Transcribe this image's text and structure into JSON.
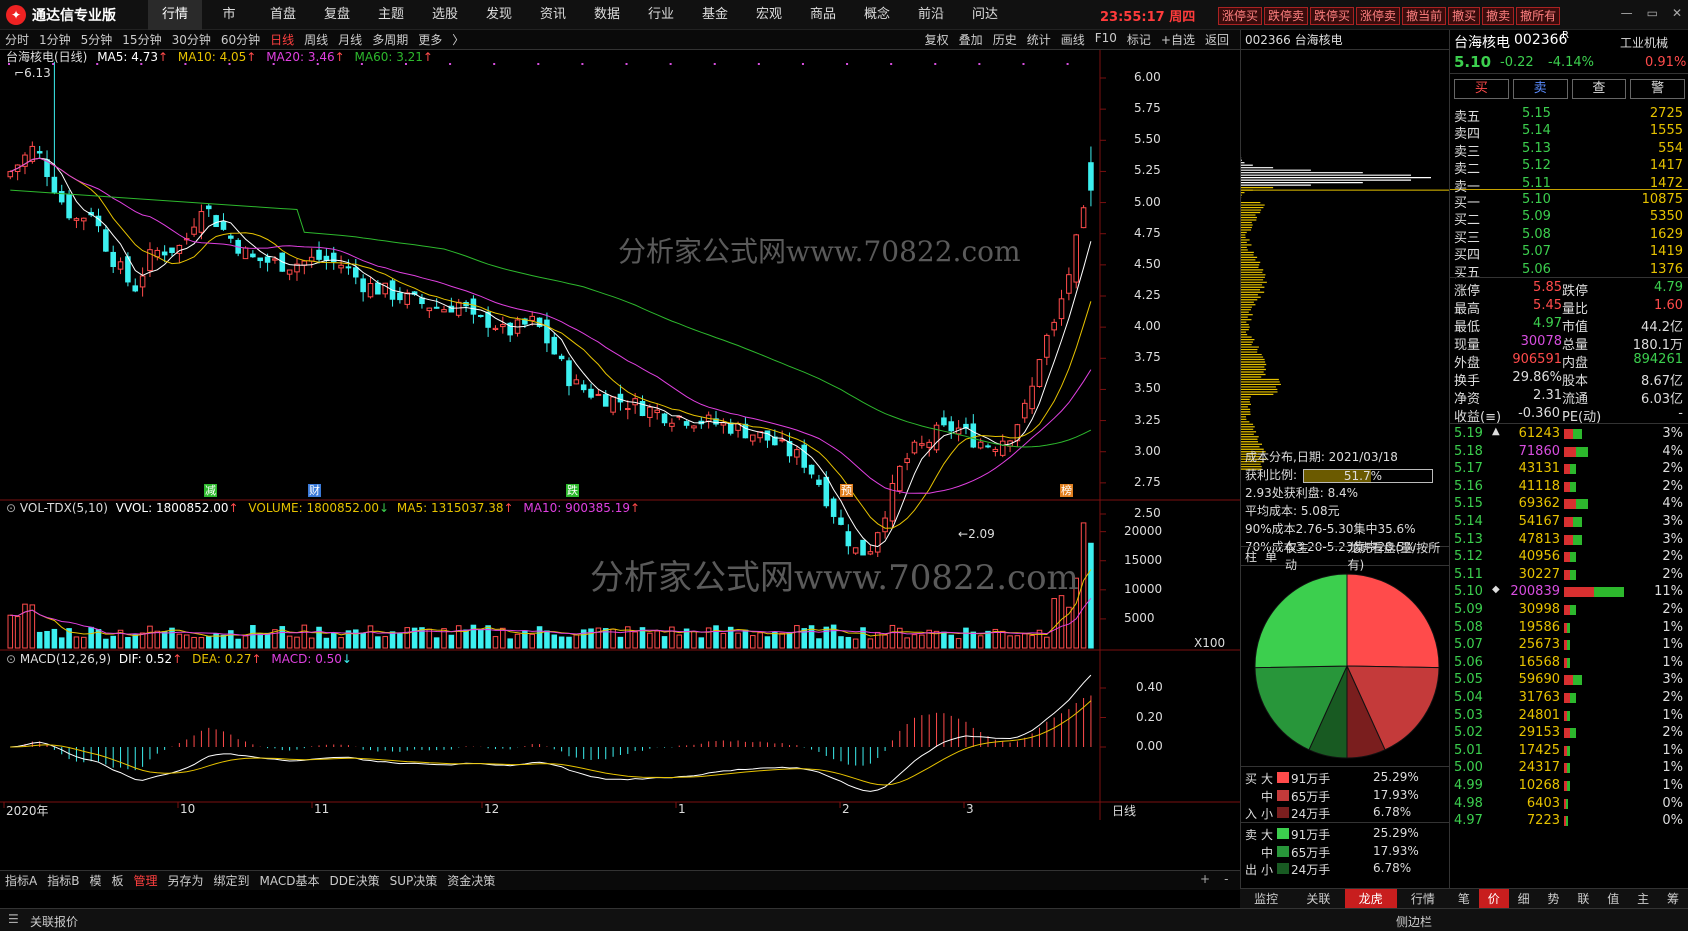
{
  "app": {
    "title": "通达信专业版"
  },
  "nav": [
    "行情",
    "市",
    "首盘",
    "复盘",
    "主题",
    "选股",
    "发现",
    "资讯",
    "数据",
    "行业",
    "基金",
    "宏观",
    "商品",
    "概念",
    "前沿",
    "问达"
  ],
  "clock": {
    "time": "23:55:17",
    "day": "周四"
  },
  "trade_buttons": [
    "涨停买",
    "跌停卖",
    "跌停买",
    "涨停卖",
    "撤当前",
    "撤买",
    "撤卖",
    "撤所有"
  ],
  "toolbar": {
    "periods": [
      "分时",
      "1分钟",
      "5分钟",
      "15分钟",
      "30分钟",
      "60分钟",
      "日线",
      "周线",
      "月线",
      "多周期",
      "更多"
    ],
    "active": "日线",
    "tools": [
      "复权",
      "叠加",
      "历史",
      "统计",
      "画线",
      "F10",
      "标记",
      "+自选",
      "返回"
    ]
  },
  "main_legend": {
    "name": "台海核电(日线)",
    "ma5": "MA5: 4.73",
    "ma10": "MA10: 4.05",
    "ma20": "MA20: 3.46",
    "ma60": "MA60: 3.21"
  },
  "annot": {
    "high": "6.13",
    "low": "2.09"
  },
  "event_tags": [
    "减",
    "财",
    "跌",
    "预",
    "榜"
  ],
  "watermark": "分析家公式网www.70822.com",
  "price_axis": [
    "6.00",
    "5.75",
    "5.50",
    "5.25",
    "5.00",
    "4.75",
    "4.50",
    "4.25",
    "4.00",
    "3.75",
    "3.50",
    "3.25",
    "3.00",
    "2.75",
    "2.50"
  ],
  "vol_legend": {
    "name": "VOL-TDX(5,10)",
    "vvol": "VVOL: 1800852.00",
    "volume": "VOLUME: 1800852.00",
    "ma5": "MA5: 1315037.38",
    "ma10": "MA10: 900385.19"
  },
  "vol_axis": [
    "20000",
    "15000",
    "10000",
    "5000"
  ],
  "vol_unit": "X100",
  "macd_legend": {
    "name": "MACD(12,26,9)",
    "dif": "DIF: 0.52",
    "dea": "DEA: 0.27",
    "macd": "MACD: 0.50"
  },
  "macd_axis": [
    "0.40",
    "0.20",
    "0.00"
  ],
  "date_axis": [
    "2020年",
    "10",
    "11",
    "12",
    "1",
    "2",
    "3"
  ],
  "date_axis_right": "日线",
  "bottom_tabs": [
    "指标A",
    "指标B",
    "模",
    "板",
    "管理",
    "另存为",
    "绑定到",
    "MACD基本",
    "DDE决策",
    "SUP决策",
    "资金决策"
  ],
  "bottom_active": "管理",
  "status": {
    "left": "关联报价",
    "right": "侧边栏"
  },
  "mid": {
    "code": "002366 台海核电",
    "cost": {
      "date": "成本分布,日期: 2021/03/18",
      "profit_label": "获利比例:",
      "profit": "51.7%",
      "line1": "2.93处获利盘: 8.4%",
      "line2": "平均成本: 5.08元",
      "line3": "90%成本2.76-5.30集中35.6%",
      "line4": "70%成本3.20-5.23集中28.5%"
    },
    "tabs": [
      "柱",
      "单",
      "仅主动",
      "龙虎看盘(量/按所有)"
    ],
    "flow": {
      "buy": [
        {
          "k": "大",
          "v": "91万手",
          "p": "25.29%",
          "c": "#ff4b4b"
        },
        {
          "k": "中",
          "v": "65万手",
          "p": "17.93%",
          "c": "#c43a3a"
        },
        {
          "k": "小",
          "v": "24万手",
          "p": "6.78%",
          "c": "#7a1e1e"
        }
      ],
      "sell": [
        {
          "k": "大",
          "v": "91万手",
          "p": "25.29%",
          "c": "#3ccf4e"
        },
        {
          "k": "中",
          "v": "65万手",
          "p": "17.93%",
          "c": "#28963a"
        },
        {
          "k": "小",
          "v": "24万手",
          "p": "6.78%",
          "c": "#185a22"
        }
      ],
      "side_buy": [
        "买",
        "入"
      ],
      "side_sell": [
        "卖",
        "出"
      ]
    },
    "bottom_tabs": [
      "监控",
      "关联",
      "龙虎",
      "行情"
    ],
    "bottom_active": "龙虎"
  },
  "quote": {
    "name": "台海核电",
    "code": "002366",
    "tag": "R",
    "industry": "工业机械",
    "price": "5.10",
    "chg": "-0.22",
    "pct": "-4.14%",
    "ratio": "0.91%",
    "buttons": [
      "买",
      "卖",
      "查",
      "警"
    ],
    "asks": [
      {
        "l": "卖五",
        "p": "5.15",
        "v": "2725"
      },
      {
        "l": "卖四",
        "p": "5.14",
        "v": "1555"
      },
      {
        "l": "卖三",
        "p": "5.13",
        "v": "554"
      },
      {
        "l": "卖二",
        "p": "5.12",
        "v": "1417"
      },
      {
        "l": "卖一",
        "p": "5.11",
        "v": "1472"
      }
    ],
    "bids": [
      {
        "l": "买一",
        "p": "5.10",
        "v": "10875"
      },
      {
        "l": "买二",
        "p": "5.09",
        "v": "5350"
      },
      {
        "l": "买三",
        "p": "5.08",
        "v": "1629"
      },
      {
        "l": "买四",
        "p": "5.07",
        "v": "1419"
      },
      {
        "l": "买五",
        "p": "5.06",
        "v": "1376"
      }
    ],
    "stats": [
      [
        {
          "l": "涨停",
          "v": "5.85",
          "c": "#ff4b4b"
        },
        {
          "l": "跌停",
          "v": "4.79",
          "c": "#3ccf4e"
        }
      ],
      [
        {
          "l": "最高",
          "v": "5.45",
          "c": "#ff4b4b"
        },
        {
          "l": "量比",
          "v": "1.60",
          "c": "#ff4b4b"
        }
      ],
      [
        {
          "l": "最低",
          "v": "4.97",
          "c": "#3ccf4e"
        },
        {
          "l": "市值",
          "v": "44.2亿",
          "c": "#ddd"
        }
      ],
      [
        {
          "l": "现量",
          "v": "30078",
          "c": "#d84ee0"
        },
        {
          "l": "总量",
          "v": "180.1万",
          "c": "#ddd"
        }
      ],
      [
        {
          "l": "外盘",
          "v": "906591",
          "c": "#ff4b4b"
        },
        {
          "l": "内盘",
          "v": "894261",
          "c": "#3ccf4e"
        }
      ],
      [
        {
          "l": "换手",
          "v": "29.86%",
          "c": "#ddd"
        },
        {
          "l": "股本",
          "v": "8.67亿",
          "c": "#ddd"
        }
      ],
      [
        {
          "l": "净资",
          "v": "2.31",
          "c": "#ddd"
        },
        {
          "l": "流通",
          "v": "6.03亿",
          "c": "#ddd"
        }
      ],
      [
        {
          "l": "收益(≡)",
          "v": "-0.360",
          "c": "#ddd"
        },
        {
          "l": "PE(动)",
          "v": "-",
          "c": "#ddd"
        }
      ]
    ],
    "ladder": [
      {
        "p": "5.19",
        "v": "61243",
        "pc": "3%",
        "m": "▲"
      },
      {
        "p": "5.18",
        "v": "71860",
        "pc": "4%",
        "m": "",
        "vc": "#d84ee0"
      },
      {
        "p": "5.17",
        "v": "43131",
        "pc": "2%",
        "m": ""
      },
      {
        "p": "5.16",
        "v": "41118",
        "pc": "2%",
        "m": ""
      },
      {
        "p": "5.15",
        "v": "69362",
        "pc": "4%",
        "m": ""
      },
      {
        "p": "5.14",
        "v": "54167",
        "pc": "3%",
        "m": ""
      },
      {
        "p": "5.13",
        "v": "47813",
        "pc": "3%",
        "m": ""
      },
      {
        "p": "5.12",
        "v": "40956",
        "pc": "2%",
        "m": ""
      },
      {
        "p": "5.11",
        "v": "30227",
        "pc": "2%",
        "m": ""
      },
      {
        "p": "5.10",
        "v": "200839",
        "pc": "11%",
        "m": "◆",
        "vc": "#d84ee0"
      },
      {
        "p": "5.09",
        "v": "30998",
        "pc": "2%",
        "m": ""
      },
      {
        "p": "5.08",
        "v": "19586",
        "pc": "1%",
        "m": ""
      },
      {
        "p": "5.07",
        "v": "25673",
        "pc": "1%",
        "m": ""
      },
      {
        "p": "5.06",
        "v": "16568",
        "pc": "1%",
        "m": ""
      },
      {
        "p": "5.05",
        "v": "59690",
        "pc": "3%",
        "m": ""
      },
      {
        "p": "5.04",
        "v": "31763",
        "pc": "2%",
        "m": ""
      },
      {
        "p": "5.03",
        "v": "24801",
        "pc": "1%",
        "m": ""
      },
      {
        "p": "5.02",
        "v": "29153",
        "pc": "2%",
        "m": ""
      },
      {
        "p": "5.01",
        "v": "17425",
        "pc": "1%",
        "m": ""
      },
      {
        "p": "5.00",
        "v": "24317",
        "pc": "1%",
        "m": ""
      },
      {
        "p": "4.99",
        "v": "10268",
        "pc": "1%",
        "m": ""
      },
      {
        "p": "4.98",
        "v": "6403",
        "pc": "0%",
        "m": ""
      },
      {
        "p": "4.97",
        "v": "7223",
        "pc": "0%",
        "m": ""
      }
    ],
    "bottom_tabs": [
      "笔",
      "价",
      "细",
      "势",
      "联",
      "值",
      "主",
      "筹"
    ],
    "bottom_active": "价"
  },
  "colors": {
    "up": "#ff4b4b",
    "down": "#3cf0f0",
    "white": "#ffffff",
    "yellow": "#e6c200",
    "magenta": "#e040e0",
    "green": "#2db82d"
  }
}
